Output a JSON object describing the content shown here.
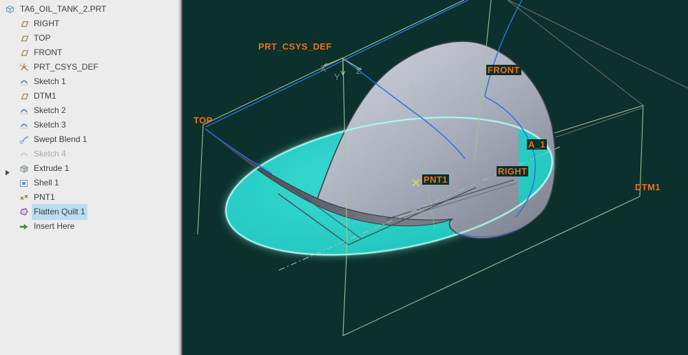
{
  "window": {
    "title": "TA6_OIL_TANK_2.PRT"
  },
  "tree": {
    "items": [
      {
        "label": "TA6_OIL_TANK_2.PRT",
        "icon": "part-icon",
        "level": 0
      },
      {
        "label": "RIGHT",
        "icon": "datum-plane-icon",
        "level": 1
      },
      {
        "label": "TOP",
        "icon": "datum-plane-icon",
        "level": 1
      },
      {
        "label": "FRONT",
        "icon": "datum-plane-icon",
        "level": 1
      },
      {
        "label": "PRT_CSYS_DEF",
        "icon": "csys-icon",
        "level": 1
      },
      {
        "label": "Sketch 1",
        "icon": "sketch-icon",
        "level": 1
      },
      {
        "label": "DTM1",
        "icon": "datum-plane-icon",
        "level": 1
      },
      {
        "label": "Sketch 2",
        "icon": "sketch-icon",
        "level": 1
      },
      {
        "label": "Sketch 3",
        "icon": "sketch-icon",
        "level": 1
      },
      {
        "label": "Swept Blend 1",
        "icon": "swept-blend-icon",
        "level": 1
      },
      {
        "label": "Sketch 4",
        "icon": "sketch-icon",
        "level": 1,
        "state": "suppressed"
      },
      {
        "label": "Extrude 1",
        "icon": "extrude-icon",
        "level": 1,
        "expandable": true
      },
      {
        "label": "Shell 1",
        "icon": "shell-icon",
        "level": 1
      },
      {
        "label": "PNT1",
        "icon": "datum-point-icon",
        "level": 1
      },
      {
        "label": "Flatten Quilt 1",
        "icon": "flatten-quilt-icon",
        "level": 1,
        "selected": true
      },
      {
        "label": "Insert Here",
        "icon": "insert-here-icon",
        "level": 1
      }
    ]
  },
  "viewport": {
    "labels": [
      {
        "text": "PRT_CSYS_DEF",
        "boxed": false
      },
      {
        "text": "TOP",
        "boxed": false
      },
      {
        "text": "FRONT",
        "boxed": true
      },
      {
        "text": "A_1",
        "boxed": true
      },
      {
        "text": "RIGHT",
        "boxed": true
      },
      {
        "text": "PNT1",
        "boxed": true
      },
      {
        "text": "DTM1",
        "boxed": false
      }
    ],
    "axis_triad": {
      "x": "X",
      "y": "Y",
      "z": "Z"
    },
    "colors": {
      "background": "#0c302c",
      "label_orange": "#ee7014",
      "quilt_cyan": "#23cfc7",
      "quilt_rim": "#b6f7f0",
      "sketch_blue": "#2b6fe0",
      "datum_green": "#a2c49c",
      "wire_gray": "#6d726c",
      "tree_selection": "#b9ddf2"
    }
  }
}
